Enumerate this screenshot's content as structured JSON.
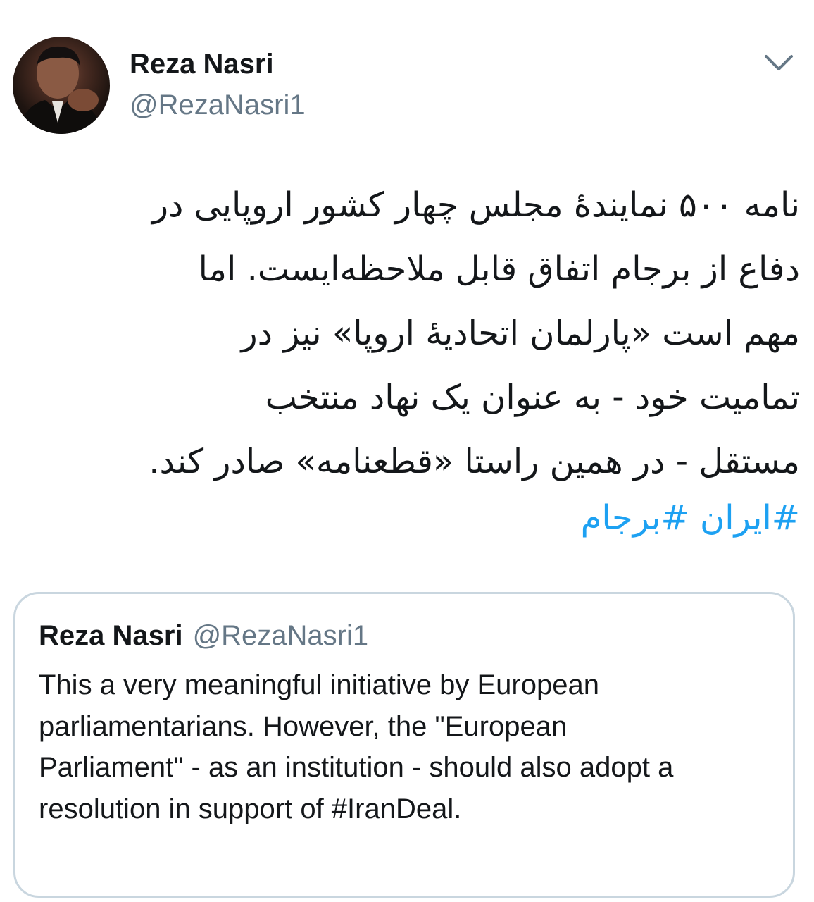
{
  "tweet": {
    "author_name": "Reza Nasri",
    "author_handle": "@RezaNasri1",
    "menu_icon": "chevron-down-icon",
    "body_lines": [
      "نامه ۵۰۰ نمایندۀ مجلس چهار کشور اروپایی در",
      "دفاع از برجام اتفاق قابل ملاحظه‌ایست. اما",
      "مهم است «پارلمان اتحادیۀ اروپا» نیز در",
      "تمامیت خود - به عنوان یک نهاد منتخب",
      "مستقل - در همین راستا «قطعنامه» صادر کند."
    ],
    "hashtags": [
      "#ایران",
      "#برجام"
    ]
  },
  "quoted_tweet": {
    "author_name": "Reza Nasri",
    "author_handle": "@RezaNasri1",
    "text_lines": [
      "This a very meaningful initiative by European",
      "parliamentarians. However, the \"European",
      "Parliament\" - as an institution - should also adopt a",
      "resolution in support of #IranDeal."
    ]
  },
  "colors": {
    "text": "#14171a",
    "secondary": "#657786",
    "link": "#1da1f2",
    "border": "#c9d6df"
  }
}
